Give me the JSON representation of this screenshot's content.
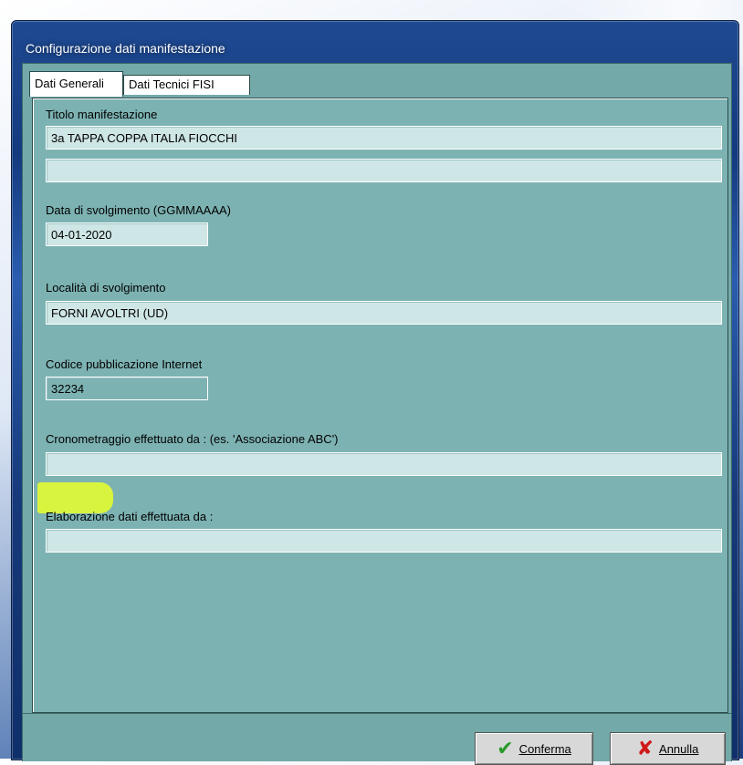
{
  "window": {
    "title": "Configurazione dati manifestazione"
  },
  "tabs": [
    {
      "label": "Dati Generali",
      "active": true
    },
    {
      "label": "Dati Tecnici FISI",
      "active": false
    }
  ],
  "fields": {
    "titolo": {
      "label": "Titolo manifestazione",
      "value_line1": "3a TAPPA COPPA ITALIA FIOCCHI",
      "value_line2": ""
    },
    "data": {
      "label": "Data di svolgimento (GGMMAAAA)",
      "value": "04-01-2020"
    },
    "localita": {
      "label": "Località di svolgimento",
      "value": "FORNI AVOLTRI (UD)"
    },
    "codice": {
      "label": "Codice pubblicazione Internet",
      "value": "32234",
      "highlight_color": "#e9ff2a"
    },
    "cronometraggio": {
      "label": "Cronometraggio effettuato da : (es. 'Associazione ABC')",
      "value": ""
    },
    "elaborazione": {
      "label": "Elaborazione dati effettuata da :",
      "value": ""
    }
  },
  "buttons": {
    "confirm": {
      "label": "Conferma",
      "icon": "check-icon"
    },
    "cancel": {
      "label": "Annulla",
      "icon": "x-icon"
    }
  },
  "colors": {
    "panel_background": "#7db2b2",
    "input_background": "#cfe6e6",
    "titlebar": "#1f4a92"
  }
}
